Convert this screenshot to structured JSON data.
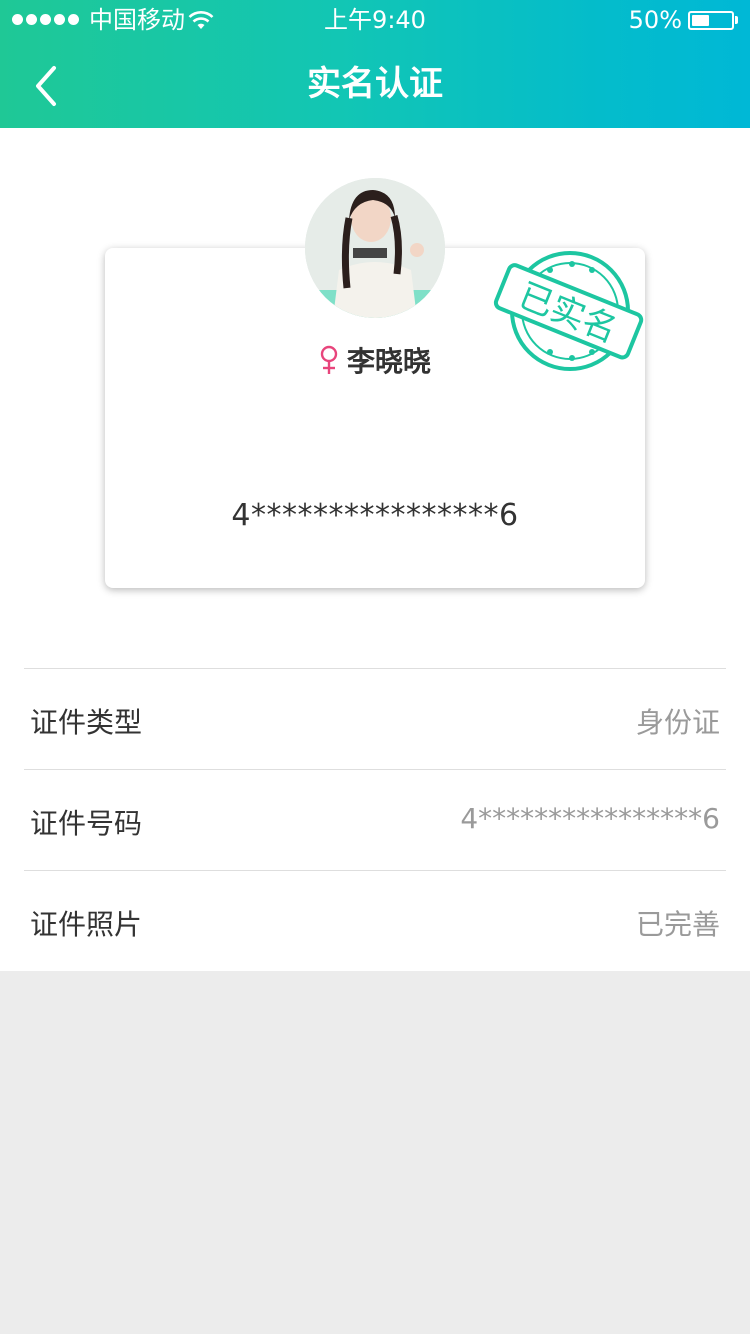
{
  "status_bar": {
    "carrier": "中国移动",
    "time": "上午9:40",
    "battery_percent": "50%",
    "battery_level": 0.5
  },
  "nav": {
    "title": "实名认证",
    "back_icon": "chevron-left-icon"
  },
  "profile": {
    "gender_icon": "female-icon",
    "gender_color": "#e8457c",
    "name": "李晓晓",
    "id_number": "4****************6",
    "stamp_text": "已实名",
    "stamp_color": "#1dc6a1"
  },
  "info_rows": [
    {
      "label": "证件类型",
      "value": "身份证"
    },
    {
      "label": "证件号码",
      "value": "4****************6"
    },
    {
      "label": "证件照片",
      "value": "已完善"
    }
  ],
  "colors": {
    "header_gradient_start": "#1fc896",
    "header_gradient_end": "#00b8d6",
    "page_background": "#ececec"
  }
}
